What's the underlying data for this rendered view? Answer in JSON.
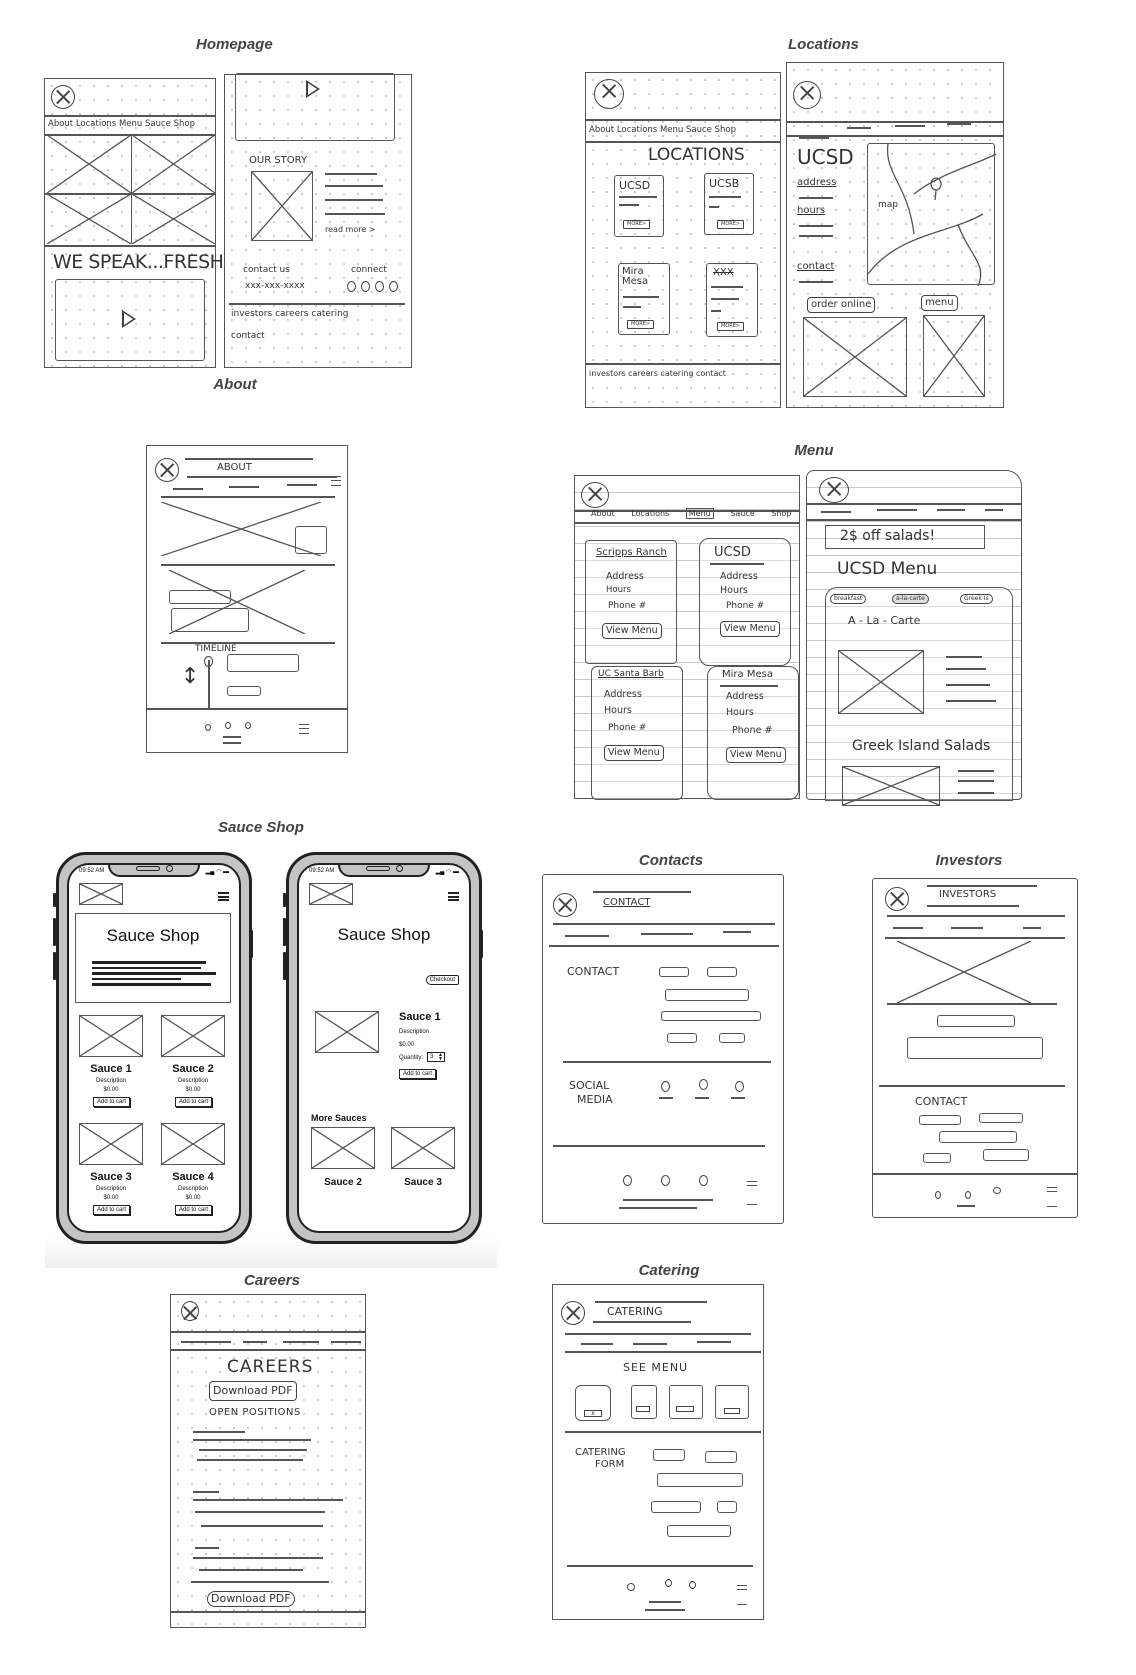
{
  "sections": {
    "homepage": "Homepage",
    "locations": "Locations",
    "about": "About",
    "menu": "Menu",
    "sauce_shop": "Sauce Shop",
    "contacts": "Contacts",
    "investors": "Investors",
    "careers": "Careers",
    "catering": "Catering"
  },
  "nav": {
    "about": "About",
    "locations": "Locations",
    "menu": "Menu",
    "sauce_shop": "Sauce Shop"
  },
  "footer_links": {
    "investors": "investors",
    "careers": "careers",
    "catering": "catering",
    "contact": "contact"
  },
  "homepage": {
    "tagline": "WE SPEAK...FRESH!",
    "our_story": "OUR STORY",
    "read_more": "read more >",
    "contact_us": "contact us",
    "phone": "xxx-xxx-xxxx",
    "connect": "connect"
  },
  "locations": {
    "heading": "LOCATIONS",
    "cards": [
      {
        "name": "UCSD",
        "button": "MORE>"
      },
      {
        "name": "UCSB",
        "button": "MORE>"
      },
      {
        "name": "Mira Mesa",
        "button": "MORE>"
      },
      {
        "name": "XXX",
        "button": "MORE>"
      }
    ],
    "detail": {
      "name": "UCSD",
      "address": "address",
      "hours": "hours",
      "contact": "contact",
      "map_label": "map",
      "order_online": "order online",
      "menu_button": "menu"
    }
  },
  "about": {
    "title": "ABOUT",
    "timeline": "TIMELINE"
  },
  "menu": {
    "cards": [
      {
        "name": "Scripps Ranch",
        "address": "Address",
        "hours": "Hours",
        "phone": "Phone #",
        "button": "View Menu"
      },
      {
        "name": "UCSD",
        "address": "Address",
        "hours": "Hours",
        "phone": "Phone #",
        "button": "View Menu"
      },
      {
        "name": "UC Santa Barb",
        "address": "Address",
        "hours": "Hours",
        "phone": "Phone #",
        "button": "View Menu"
      },
      {
        "name": "Mira Mesa",
        "address": "Address",
        "hours": "Hours",
        "phone": "Phone #",
        "button": "View Menu"
      }
    ],
    "detail": {
      "promo": "2$ off salads!",
      "title": "UCSD Menu",
      "tabs": [
        "breakfast",
        "a-la-carte",
        "Greek Is"
      ],
      "section1": "A - La - Carte",
      "section2": "Greek Island Salads"
    }
  },
  "sauce_shop": {
    "time": "09:52 AM",
    "title": "Sauce Shop",
    "products": [
      {
        "name": "Sauce 1",
        "description": "Description",
        "price": "$0.00",
        "button": "Add to cart"
      },
      {
        "name": "Sauce 2",
        "description": "Description",
        "price": "$0.00",
        "button": "Add to cart"
      },
      {
        "name": "Sauce 3",
        "description": "Description",
        "price": "$0.00",
        "button": "Add to cart"
      },
      {
        "name": "Sauce 4",
        "description": "Description",
        "price": "$0.00",
        "button": "Add to cart"
      }
    ],
    "detail": {
      "checkout": "Checkout",
      "name": "Sauce 1",
      "description": "Description",
      "price": "$0.00",
      "quantity_label": "Quantity:",
      "quantity_value": "3",
      "button": "Add to cart",
      "more_heading": "More Sauces",
      "more": [
        "Sauce 2",
        "Sauce 3"
      ]
    }
  },
  "contacts": {
    "title": "CONTACT",
    "form_label": "CONTACT",
    "social_label_1": "SOCIAL",
    "social_label_2": "MEDIA"
  },
  "investors": {
    "title": "INVESTORS",
    "contact_label": "CONTACT"
  },
  "careers": {
    "title": "CAREERS",
    "download_top": "Download PDF",
    "open_positions": "OPEN POSITIONS",
    "download_bottom": "Download PDF"
  },
  "catering": {
    "title": "CATERING",
    "see_menu": "SEE MENU",
    "form_label_1": "CATERING",
    "form_label_2": "FORM"
  }
}
